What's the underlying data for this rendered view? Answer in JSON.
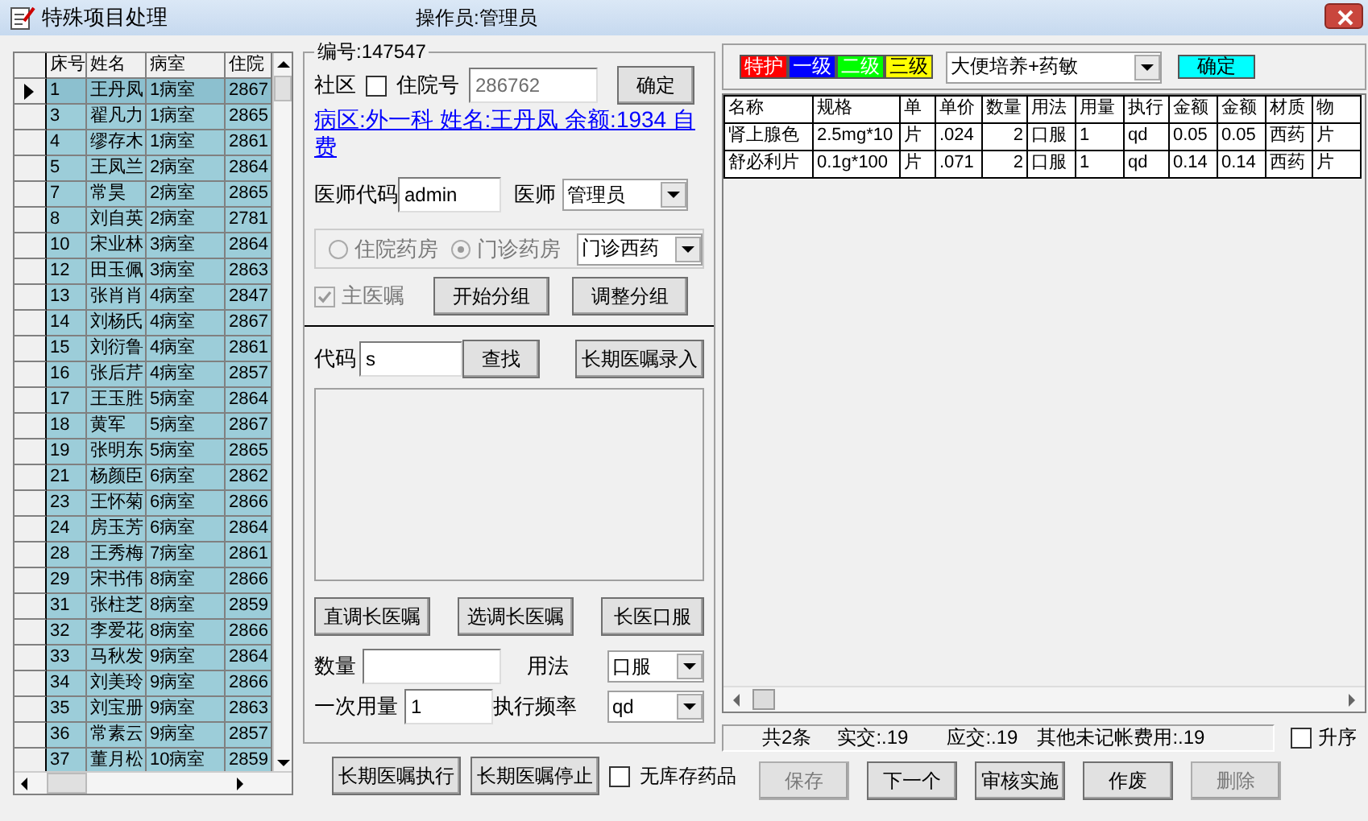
{
  "window": {
    "title": "特殊项目处理",
    "operator": "操作员:管理员"
  },
  "patient_grid": {
    "columns": [
      "床号",
      "姓名",
      "病室",
      "住院"
    ],
    "rows": [
      {
        "cells": [
          "1",
          "王丹凤",
          "1病室",
          "2867"
        ],
        "selected": true
      },
      {
        "cells": [
          "3",
          "翟凡力",
          "1病室",
          "2865"
        ],
        "selected": false
      },
      {
        "cells": [
          "4",
          "缪存木",
          "1病室",
          "2861"
        ],
        "selected": false
      },
      {
        "cells": [
          "5",
          "王凤兰",
          "2病室",
          "2864"
        ],
        "selected": false
      },
      {
        "cells": [
          "7",
          "常昊",
          "2病室",
          "2865"
        ],
        "selected": false
      },
      {
        "cells": [
          "8",
          "刘自英",
          "2病室",
          "2781"
        ],
        "selected": false
      },
      {
        "cells": [
          "10",
          "宋业林",
          "3病室",
          "2864"
        ],
        "selected": false
      },
      {
        "cells": [
          "12",
          "田玉佩",
          "3病室",
          "2863"
        ],
        "selected": false
      },
      {
        "cells": [
          "13",
          "张肖肖",
          "4病室",
          "2847"
        ],
        "selected": false
      },
      {
        "cells": [
          "14",
          "刘杨氏",
          "4病室",
          "2867"
        ],
        "selected": false
      },
      {
        "cells": [
          "15",
          "刘衍鲁",
          "4病室",
          "2861"
        ],
        "selected": false
      },
      {
        "cells": [
          "16",
          "张后芹",
          "4病室",
          "2857"
        ],
        "selected": false
      },
      {
        "cells": [
          "17",
          "王玉胜",
          "5病室",
          "2864"
        ],
        "selected": false
      },
      {
        "cells": [
          "18",
          "黄军",
          "5病室",
          "2867"
        ],
        "selected": false
      },
      {
        "cells": [
          "19",
          "张明东",
          "5病室",
          "2865"
        ],
        "selected": false
      },
      {
        "cells": [
          "21",
          "杨颜臣",
          "6病室",
          "2862"
        ],
        "selected": false
      },
      {
        "cells": [
          "23",
          "王怀菊",
          "6病室",
          "2866"
        ],
        "selected": false
      },
      {
        "cells": [
          "24",
          "房玉芳",
          "6病室",
          "2864"
        ],
        "selected": false
      },
      {
        "cells": [
          "28",
          "王秀梅",
          "7病室",
          "2861"
        ],
        "selected": false
      },
      {
        "cells": [
          "29",
          "宋书伟",
          "8病室",
          "2866"
        ],
        "selected": false
      },
      {
        "cells": [
          "31",
          "张柱芝",
          "8病室",
          "2859"
        ],
        "selected": false
      },
      {
        "cells": [
          "32",
          "李爱花",
          "8病室",
          "2866"
        ],
        "selected": false
      },
      {
        "cells": [
          "33",
          "马秋发",
          "9病室",
          "2864"
        ],
        "selected": false
      },
      {
        "cells": [
          "34",
          "刘美玲",
          "9病室",
          "2866"
        ],
        "selected": false
      },
      {
        "cells": [
          "35",
          "刘宝册",
          "9病室",
          "2863"
        ],
        "selected": false
      },
      {
        "cells": [
          "36",
          "常素云",
          "9病室",
          "2857"
        ],
        "selected": false
      },
      {
        "cells": [
          "37",
          "董月松",
          "10病室",
          "2859"
        ],
        "selected": false
      }
    ]
  },
  "patient_form": {
    "group_title": "编号:147547",
    "community": {
      "label": "社区",
      "checked": false
    },
    "admission": {
      "label": "住院号",
      "value": "286762"
    },
    "confirm_button": "确定",
    "info_link": "病区:外一科 姓名:王丹凤 余额:1934 自费",
    "doctor_code": {
      "label": "医师代码",
      "value": "admin"
    },
    "doctor": {
      "label": "医师",
      "value": "管理员"
    },
    "pharmacy": {
      "disabled": true,
      "options": [
        {
          "label": "住院药房",
          "selected": false
        },
        {
          "label": "门诊药房",
          "selected": true
        }
      ],
      "select": "门诊西药"
    },
    "main_order": {
      "label": "主医嘱",
      "checked": true,
      "disabled": true
    },
    "group_buttons": [
      "开始分组",
      "调整分组"
    ]
  },
  "order_entry": {
    "code": {
      "label": "代码",
      "value": "s"
    },
    "find_button": "查找",
    "entry_button": "长期医嘱录入",
    "action_buttons": [
      "直调长医嘱",
      "选调长医嘱",
      "长医口服"
    ],
    "quantity": {
      "label": "数量"
    },
    "usage": {
      "label": "用法",
      "value": "口服"
    },
    "dose": {
      "label": "一次用量",
      "value": "1"
    },
    "frequency": {
      "label": "执行频率",
      "value": "qd"
    }
  },
  "order_buttons": [
    "长期医嘱执行",
    "长期医嘱停止"
  ],
  "no_stock": {
    "label": "无库存药品",
    "checked": false
  },
  "care_levels": [
    {
      "label": "特护",
      "color": "#ff0000"
    },
    {
      "label": "一级",
      "color": "#0000ff"
    },
    {
      "label": "二级",
      "color": "#00ff00"
    },
    {
      "label": "三级",
      "color": "#ffff00"
    }
  ],
  "item_select": "大便培养+药敏",
  "item_confirm": "确定",
  "item_table": {
    "columns": [
      "名称",
      "规格",
      "单",
      "单价",
      "数量",
      "用法",
      "用量",
      "执行",
      "金额",
      "金额",
      "材质",
      "物"
    ],
    "rows": [
      [
        "肾上腺色",
        "2.5mg*10",
        "片",
        ".024",
        "2",
        "口服",
        "1",
        "qd",
        "0.05",
        "0.05",
        "西药",
        "片"
      ],
      [
        "舒必利片",
        "0.1g*100",
        "片",
        ".071",
        "2",
        "口服",
        "1",
        "qd",
        "0.14",
        "0.14",
        "西药",
        "片"
      ]
    ]
  },
  "status_bar": [
    "共2条",
    "实交:.19",
    "应交:.19",
    "其他未记帐费用:.19"
  ],
  "ascending": {
    "label": "升序",
    "checked": false
  },
  "bottom_buttons": [
    {
      "label": "保存",
      "disabled": true
    },
    {
      "label": "下一个",
      "disabled": false
    },
    {
      "label": "审核实施",
      "disabled": false
    },
    {
      "label": "作废",
      "disabled": false
    },
    {
      "label": "删除",
      "disabled": true
    }
  ]
}
